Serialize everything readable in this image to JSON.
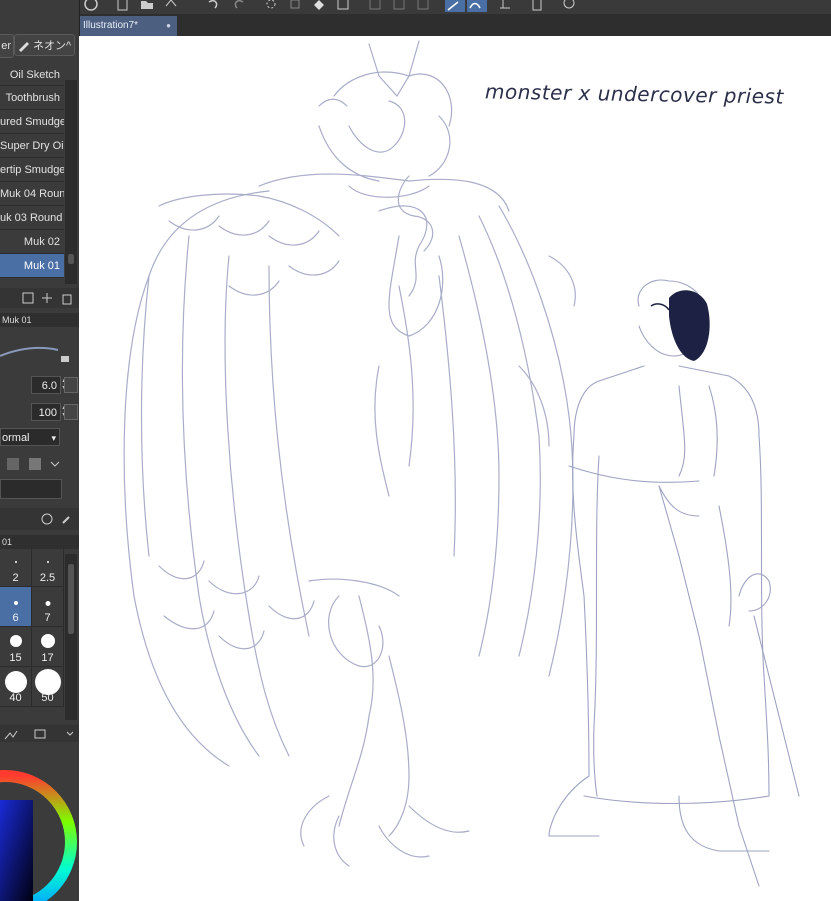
{
  "app": {
    "document_tab": "Illustration7*",
    "accent_color": "#4a6fa5"
  },
  "subtool": {
    "left_pill": "er",
    "right_pill": "ネオン^",
    "brushes": [
      {
        "label": "Oil Sketch",
        "selected": false
      },
      {
        "label": "Toothbrush",
        "selected": false
      },
      {
        "label": "ured Smudge",
        "selected": false
      },
      {
        "label": "Super Dry Oil",
        "selected": false
      },
      {
        "label": "ertip Smudge",
        "selected": false
      },
      {
        "label": "Muk 04 Round",
        "selected": false
      },
      {
        "label": "uk 03 Round",
        "selected": false
      },
      {
        "label": "Muk 02",
        "selected": false
      },
      {
        "label": "Muk 01",
        "selected": true
      }
    ]
  },
  "tool_property": {
    "title": "Muk 01",
    "brush_size": "6.0",
    "opacity": "100",
    "blend_mode": "ormal"
  },
  "brush_size_palette": {
    "title": "01",
    "sizes": [
      "2",
      "2.5",
      "6",
      "7",
      "15",
      "17",
      "40",
      "50"
    ],
    "selected": "6"
  },
  "canvas": {
    "caption": "monster x undercover priest"
  }
}
